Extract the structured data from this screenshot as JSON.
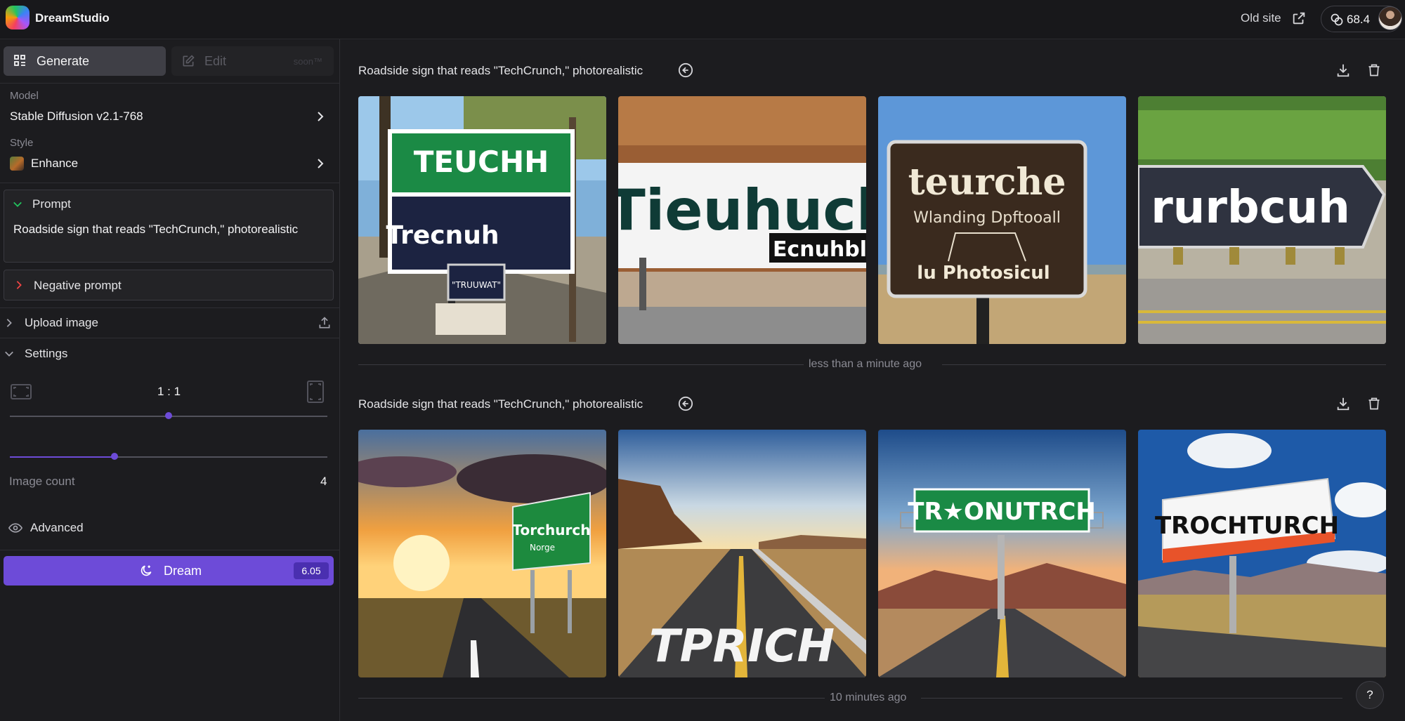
{
  "app": {
    "name": "DreamStudio"
  },
  "header": {
    "old_site": "Old site",
    "credits": "68.4"
  },
  "sidebar": {
    "tabs": {
      "generate": "Generate",
      "edit": "Edit",
      "edit_badge": "soon™"
    },
    "model": {
      "label": "Model",
      "value": "Stable Diffusion v2.1-768"
    },
    "style": {
      "label": "Style",
      "value": "Enhance"
    },
    "prompt": {
      "title": "Prompt",
      "text": "Roadside sign that reads \"TechCrunch,\" photorealistic"
    },
    "negative_prompt": {
      "title": "Negative prompt"
    },
    "upload_image": "Upload image",
    "settings": {
      "title": "Settings",
      "aspect_ratio": "1 : 1",
      "aspect_ratio_position": 0.5,
      "image_count_label": "Image count",
      "image_count": "4",
      "image_count_position": 0.33,
      "advanced": "Advanced"
    },
    "dream": {
      "label": "Dream",
      "cost": "6.05"
    }
  },
  "generations": [
    {
      "prompt": "Roadside sign that reads \"TechCrunch,\" photorealistic",
      "time": "less than a minute ago",
      "images": [
        {
          "sign_lines": [
            "TEUCHH",
            "Trecnuh"
          ],
          "subject": "green and navy roadside sign"
        },
        {
          "sign_lines": [
            "Tieuhuch",
            "Ecnuhbl"
          ],
          "subject": "white billboard in desert"
        },
        {
          "sign_lines": [
            "teurche",
            "Wlanding Dpftooall",
            "lu Photosicul"
          ],
          "subject": "brown wooden sign"
        },
        {
          "sign_lines": [
            "rurbcuh"
          ],
          "subject": "dark roadside sign with hedge"
        }
      ]
    },
    {
      "prompt": "Roadside sign that reads \"TechCrunch,\" photorealistic",
      "time": "10 minutes ago",
      "images": [
        {
          "sign_lines": [
            "Torchurch",
            "Norge"
          ],
          "subject": "sunset road with green sign"
        },
        {
          "sign_lines": [
            "TPRICH"
          ],
          "subject": "desert highway with painted text"
        },
        {
          "sign_lines": [
            "TR★ONUTRCH"
          ],
          "subject": "highway gantry sign at dusk"
        },
        {
          "sign_lines": [
            "TROCHTURCH"
          ],
          "subject": "billboard under blue sky"
        }
      ]
    }
  ],
  "help": "?"
}
